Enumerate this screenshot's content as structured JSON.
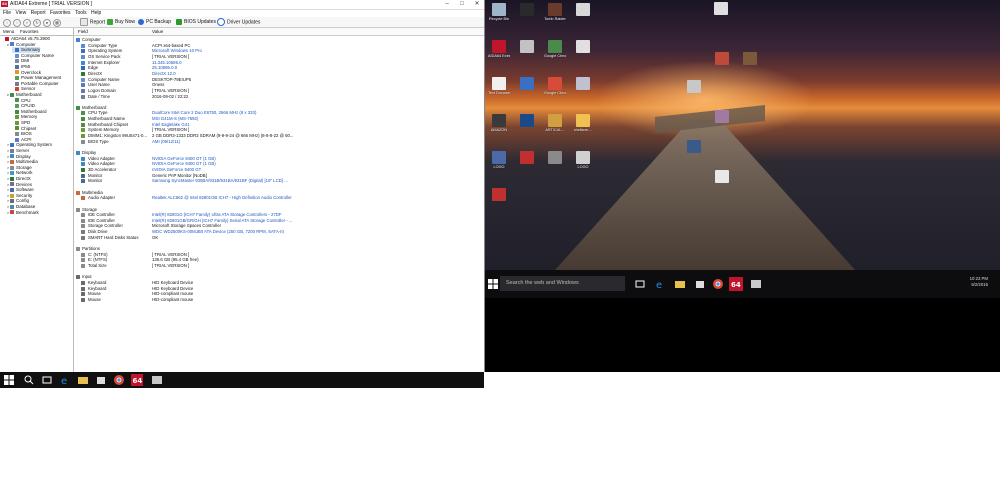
{
  "window": {
    "app_icon": "64",
    "title": "AIDA64 Extreme  [ TRIAL VERSION ]",
    "min": "–",
    "max": "□",
    "close": "✕"
  },
  "menu": [
    "File",
    "View",
    "Report",
    "Favorites",
    "Tools",
    "Help"
  ],
  "toolbar": {
    "report": "Report",
    "buy_now": "Buy Now",
    "pc_backup": "PC Backup",
    "bios_updates": "BIOS Updates",
    "driver_updates": "Driver Updates"
  },
  "left_tabs": {
    "menu": "Menu",
    "favorites": "Favorites"
  },
  "tree": [
    {
      "label": "AIDA64 v5.75.3900",
      "indent": 0,
      "color": "#c0152a",
      "exp": ""
    },
    {
      "label": "Computer",
      "indent": 1,
      "color": "#4a7bd0",
      "exp": "v"
    },
    {
      "label": "Summary",
      "indent": 2,
      "color": "#3a6fc4",
      "exp": "",
      "sel": true
    },
    {
      "label": "Computer Name",
      "indent": 2,
      "color": "#6b8fcf",
      "exp": ""
    },
    {
      "label": "DMI",
      "indent": 2,
      "color": "#7a8aa6",
      "exp": ""
    },
    {
      "label": "IPMI",
      "indent": 2,
      "color": "#5c6f8f",
      "exp": ""
    },
    {
      "label": "Overclock",
      "indent": 2,
      "color": "#e0962a",
      "exp": ""
    },
    {
      "label": "Power Management",
      "indent": 2,
      "color": "#4fa54a",
      "exp": ""
    },
    {
      "label": "Portable Computer",
      "indent": 2,
      "color": "#6d7d9a",
      "exp": ""
    },
    {
      "label": "Sensor",
      "indent": 2,
      "color": "#d7402a",
      "exp": ""
    },
    {
      "label": "Motherboard",
      "indent": 1,
      "color": "#3f8f3f",
      "exp": "v"
    },
    {
      "label": "CPU",
      "indent": 2,
      "color": "#4d8f4d",
      "exp": ""
    },
    {
      "label": "CPUID",
      "indent": 2,
      "color": "#5b9a5b",
      "exp": ""
    },
    {
      "label": "Motherboard",
      "indent": 2,
      "color": "#3f8f3f",
      "exp": ""
    },
    {
      "label": "Memory",
      "indent": 2,
      "color": "#6a9a3a",
      "exp": ""
    },
    {
      "label": "SPD",
      "indent": 2,
      "color": "#6a9a3a",
      "exp": ""
    },
    {
      "label": "Chipset",
      "indent": 2,
      "color": "#5a8a3a",
      "exp": ""
    },
    {
      "label": "BIOS",
      "indent": 2,
      "color": "#8a8a8a",
      "exp": ""
    },
    {
      "label": "ACPI",
      "indent": 2,
      "color": "#5a7acc",
      "exp": ""
    },
    {
      "label": "Operating System",
      "indent": 1,
      "color": "#3a6fc4",
      "exp": ">"
    },
    {
      "label": "Server",
      "indent": 1,
      "color": "#7a7a8a",
      "exp": ">"
    },
    {
      "label": "Display",
      "indent": 1,
      "color": "#3a8ac4",
      "exp": ">"
    },
    {
      "label": "Multimedia",
      "indent": 1,
      "color": "#c46a3a",
      "exp": ">"
    },
    {
      "label": "Storage",
      "indent": 1,
      "color": "#8a8a8a",
      "exp": ">"
    },
    {
      "label": "Network",
      "indent": 1,
      "color": "#3a9ac4",
      "exp": ">"
    },
    {
      "label": "DirectX",
      "indent": 1,
      "color": "#2a7a2a",
      "exp": ">"
    },
    {
      "label": "Devices",
      "indent": 1,
      "color": "#7a6a9a",
      "exp": ">"
    },
    {
      "label": "Software",
      "indent": 1,
      "color": "#4a6aaa",
      "exp": ">"
    },
    {
      "label": "Security",
      "indent": 1,
      "color": "#c4a03a",
      "exp": ">"
    },
    {
      "label": "Config",
      "indent": 1,
      "color": "#6a6a6a",
      "exp": ">"
    },
    {
      "label": "Database",
      "indent": 1,
      "color": "#4a8aa4",
      "exp": ">"
    },
    {
      "label": "Benchmark",
      "indent": 1,
      "color": "#c44a3a",
      "exp": ">"
    }
  ],
  "columns": {
    "field": "Field",
    "value": "Value"
  },
  "rows": [
    {
      "type": "sec",
      "field": "Computer",
      "value": "",
      "color": "#4a7bd0",
      "y": 0
    },
    {
      "field": "Computer Type",
      "value": "ACPI x64-based PC",
      "link": false,
      "color": "#5a8ad0",
      "y": 1
    },
    {
      "field": "Operating System",
      "value": "Microsoft Windows 10 Pro",
      "link": true,
      "color": "#3a6fc4",
      "y": 2
    },
    {
      "field": "OS Service Pack",
      "value": "[ TRIAL VERSION ]",
      "link": false,
      "color": "#6a8ac0",
      "y": 3
    },
    {
      "field": "Internet Explorer",
      "value": "11.345.10586.0",
      "link": true,
      "color": "#3a8ae0",
      "y": 4
    },
    {
      "field": "Edge",
      "value": "25.10586.0.0",
      "link": true,
      "color": "#2a6ad0",
      "y": 5
    },
    {
      "field": "DirectX",
      "value": "DirectX 12.0",
      "link": true,
      "color": "#2a7a2a",
      "y": 6
    },
    {
      "field": "Computer Name",
      "value": "DESKTOP-79EIUP5",
      "link": false,
      "color": "#6b8fcf",
      "y": 7
    },
    {
      "field": "User Name",
      "value": "Oness",
      "link": false,
      "color": "#5a7aba",
      "y": 8
    },
    {
      "field": "Logon Domain",
      "value": "[ TRIAL VERSION ]",
      "link": false,
      "color": "#5a7aba",
      "y": 9
    },
    {
      "field": "Date / Time",
      "value": "2016-09-02 / 22:22",
      "link": false,
      "color": "#7a7a9a",
      "y": 10
    },
    {
      "type": "sec",
      "field": "Motherboard",
      "value": "",
      "color": "#3f8f3f",
      "y": 12
    },
    {
      "field": "CPU Type",
      "value": "DualCore Intel Core 2 Duo E6750, 2666 MHz (8 x 333)",
      "link": true,
      "color": "#4d8f4d",
      "y": 13
    },
    {
      "field": "Motherboard Name",
      "value": "MSI G41M-S (MS-7592)",
      "link": true,
      "color": "#3f8f3f",
      "y": 14
    },
    {
      "field": "Motherboard Chipset",
      "value": "Intel Eaglelake G41",
      "link": true,
      "color": "#5a8a3a",
      "y": 15
    },
    {
      "field": "System Memory",
      "value": "[ TRIAL VERSION ]",
      "link": false,
      "color": "#6a9a3a",
      "y": 16
    },
    {
      "field": "DIMM1: Kingston 99U5471-0...",
      "value": "2 GB DDR3-1333 DDR3 SDRAM  (9-9-9-24 @ 666 MHz)  (8-8-8-22 @ 60...",
      "link": false,
      "color": "#6a9a3a",
      "y": 17
    },
    {
      "field": "BIOS Type",
      "value": "AMI (09/12/11)",
      "link": true,
      "color": "#8a8a8a",
      "y": 18
    },
    {
      "type": "sec",
      "field": "Display",
      "value": "",
      "color": "#3a8ac4",
      "y": 20
    },
    {
      "field": "Video Adapter",
      "value": "NVIDIA GeForce 9400 GT  (1 GB)",
      "link": true,
      "color": "#3a8ac4",
      "y": 21
    },
    {
      "field": "Video Adapter",
      "value": "NVIDIA GeForce 9400 GT  (1 GB)",
      "link": true,
      "color": "#3a8ac4",
      "y": 22
    },
    {
      "field": "3D Accelerator",
      "value": "nVIDIA GeForce 9400 GT",
      "link": true,
      "color": "#2a7a2a",
      "y": 23
    },
    {
      "field": "Monitor",
      "value": "Generic PnP Monitor [NoDB]",
      "link": false,
      "color": "#4a6a8a",
      "y": 24
    },
    {
      "field": "Monitor",
      "value": "Samsung SyncMaster 930BA/931B/931BA/931BF (Digital)  [19\" LCD]  ...",
      "link": true,
      "color": "#4a6a8a",
      "y": 25
    },
    {
      "type": "sec",
      "field": "Multimedia",
      "value": "",
      "color": "#c46a3a",
      "y": 27
    },
    {
      "field": "Audio Adapter",
      "value": "Realtek ALC662 @ Intel 82801GB ICH7 - High Definition Audio Controller",
      "link": true,
      "color": "#c46a3a",
      "y": 28
    },
    {
      "type": "sec",
      "field": "Storage",
      "value": "",
      "color": "#8a8a8a",
      "y": 30
    },
    {
      "field": "IDE Controller",
      "value": "Intel(R) 82801G (ICH7 Family) Ultra ATA Storage Controllers - 27DF",
      "link": true,
      "color": "#8a8a8a",
      "y": 31
    },
    {
      "field": "IDE Controller",
      "value": "Intel(R) 82801GB/GR/GH (ICH7 Family) Serial ATA Storage Controller - ...",
      "link": true,
      "color": "#8a8a8a",
      "y": 32
    },
    {
      "field": "Storage Controller",
      "value": "Microsoft Storage Spaces Controller",
      "link": false,
      "color": "#8a8a8a",
      "y": 33
    },
    {
      "field": "Disk Drive",
      "value": "WDC WD2500KS-00MJB0 ATA Device  (250 GB, 7200 RPM, SATA-II)",
      "link": true,
      "color": "#7a7a7a",
      "y": 34
    },
    {
      "field": "SMART Hard Disks Status",
      "value": "OK",
      "link": false,
      "color": "#7a7a7a",
      "y": 35
    },
    {
      "type": "sec",
      "field": "Partitions",
      "value": "",
      "color": "#8a8a8a",
      "y": 37
    },
    {
      "field": "C: (NTFS)",
      "value": "[ TRIAL VERSION ]",
      "link": false,
      "color": "#8a8a8a",
      "y": 38
    },
    {
      "field": "E: (NTFS)",
      "value": "136.6 GB (95.4 GB free)",
      "link": false,
      "color": "#8a8a8a",
      "y": 39
    },
    {
      "field": "Total Size",
      "value": "[ TRIAL VERSION ]",
      "link": false,
      "color": "#8a8a8a",
      "y": 40
    },
    {
      "type": "sec",
      "field": "Input",
      "value": "",
      "color": "#6a6a6a",
      "y": 42
    },
    {
      "field": "Keyboard",
      "value": "HID Keyboard Device",
      "link": false,
      "color": "#6a6a6a",
      "y": 43
    },
    {
      "field": "Keyboard",
      "value": "HID Keyboard Device",
      "link": false,
      "color": "#6a6a6a",
      "y": 44
    },
    {
      "field": "Mouse",
      "value": "HID-compliant mouse",
      "link": false,
      "color": "#6a6a6a",
      "y": 45
    },
    {
      "field": "Mouse",
      "value": "HID-compliant mouse",
      "link": false,
      "color": "#6a6a6a",
      "y": 46
    }
  ],
  "desktop_icons": [
    {
      "label": "Recycle Bin",
      "color": "#9fb6c8"
    },
    {
      "label": "",
      "color": "#2a2a2a"
    },
    {
      "label": "Tomb Raider",
      "color": "#6a3a2a"
    },
    {
      "label": "",
      "color": "#d8d8d8"
    },
    {
      "label": "AIDA64 Extreme",
      "color": "#c0152a"
    },
    {
      "label": "",
      "color": "#c2c2c2"
    },
    {
      "label": "Google Chrome",
      "color": "#4a8a4a"
    },
    {
      "label": "",
      "color": "#e0e0e0"
    },
    {
      "label": "Text Document",
      "color": "#f0f0f0"
    },
    {
      "label": "",
      "color": "#3a6fc4"
    },
    {
      "label": "Google Chrome",
      "color": "#d84a3a"
    },
    {
      "label": "",
      "color": "#c0c0d0"
    },
    {
      "label": "AMAZON",
      "color": "#3a3a3a"
    },
    {
      "label": "",
      "color": "#1a4a8a"
    },
    {
      "label": "ARTICUL...",
      "color": "#d0a040"
    },
    {
      "label": "chellane-...",
      "color": "#f0c050"
    },
    {
      "label": "LOGO",
      "color": "#4a6aaa"
    },
    {
      "label": "",
      "color": "#c03030"
    },
    {
      "label": "",
      "color": "#8a8a8a"
    },
    {
      "label": "LOGO",
      "color": "#d0d0d0"
    },
    {
      "label": "",
      "color": "#c03030"
    }
  ],
  "desktop_right_icons": [
    {
      "label": "",
      "color": "#e0e0e0"
    },
    {
      "label": "",
      "color": "#c04a3a"
    },
    {
      "label": "",
      "color": "#7a5a3a"
    },
    {
      "label": "",
      "color": "#c8c8c8"
    },
    {
      "label": "",
      "color": "#a07aa0"
    },
    {
      "label": "",
      "color": "#3a5a8a"
    },
    {
      "label": "",
      "color": "#e8e8e8"
    }
  ],
  "taskbar": {
    "search_placeholder": "Search the web and Windows",
    "time": "10:23 PM",
    "date": "9/2/2016"
  }
}
